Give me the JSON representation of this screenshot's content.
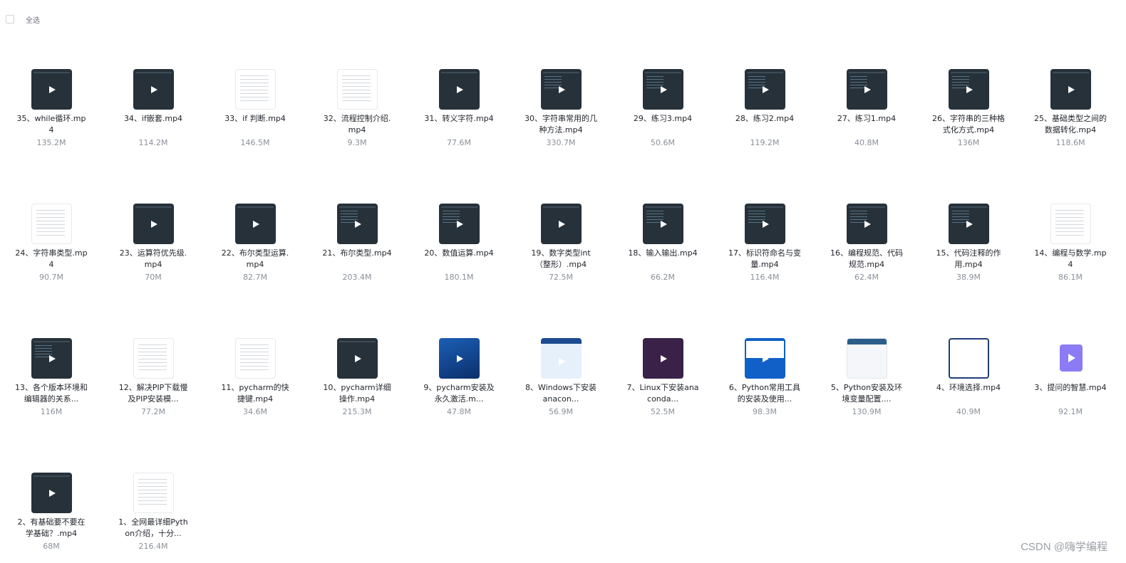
{
  "toolbar": {
    "select_all_label": "全选"
  },
  "files": [
    {
      "name": "35、while循环.mp4",
      "size": "135.2M",
      "thumb": "dark"
    },
    {
      "name": "34、if嵌套.mp4",
      "size": "114.2M",
      "thumb": "dark"
    },
    {
      "name": "33、if 判断.mp4",
      "size": "146.5M",
      "thumb": "doc"
    },
    {
      "name": "32、流程控制介绍.mp4",
      "size": "9.3M",
      "thumb": "doc"
    },
    {
      "name": "31、转义字符.mp4",
      "size": "77.6M",
      "thumb": "dark"
    },
    {
      "name": "30、字符串常用的几种方法.mp4",
      "size": "330.7M",
      "thumb": "code"
    },
    {
      "name": "29、练习3.mp4",
      "size": "50.6M",
      "thumb": "code"
    },
    {
      "name": "28、练习2.mp4",
      "size": "119.2M",
      "thumb": "code"
    },
    {
      "name": "27、练习1.mp4",
      "size": "40.8M",
      "thumb": "code"
    },
    {
      "name": "26、字符串的三种格式化方式.mp4",
      "size": "136M",
      "thumb": "code"
    },
    {
      "name": "25、基础类型之间的数据转化.mp4",
      "size": "118.6M",
      "thumb": "dark"
    },
    {
      "name": "24、字符串类型.mp4",
      "size": "90.7M",
      "thumb": "doc"
    },
    {
      "name": "23、运算符优先级.mp4",
      "size": "70M",
      "thumb": "dark"
    },
    {
      "name": "22、布尔类型运算.mp4",
      "size": "82.7M",
      "thumb": "dark"
    },
    {
      "name": "21、布尔类型.mp4",
      "size": "203.4M",
      "thumb": "code"
    },
    {
      "name": "20、数值运算.mp4",
      "size": "180.1M",
      "thumb": "code"
    },
    {
      "name": "19、数字类型int（整形）.mp4",
      "size": "72.5M",
      "thumb": "dark"
    },
    {
      "name": "18、输入输出.mp4",
      "size": "66.2M",
      "thumb": "code"
    },
    {
      "name": "17、标识符命名与变量.mp4",
      "size": "116.4M",
      "thumb": "code"
    },
    {
      "name": "16、编程规范、代码规范.mp4",
      "size": "62.4M",
      "thumb": "code"
    },
    {
      "name": "15、代码注释的作用.mp4",
      "size": "38.9M",
      "thumb": "code"
    },
    {
      "name": "14、编程与数学.mp4",
      "size": "86.1M",
      "thumb": "doc"
    },
    {
      "name": "13、各个版本环境和编辑器的关系...",
      "size": "116M",
      "thumb": "code"
    },
    {
      "name": "12、解决PIP下载慢及PIP安装模...",
      "size": "77.2M",
      "thumb": "doc"
    },
    {
      "name": "11、pycharm的快捷键.mp4",
      "size": "34.6M",
      "thumb": "doc"
    },
    {
      "name": "10、pycharm详细操作.mp4",
      "size": "215.3M",
      "thumb": "dark"
    },
    {
      "name": "9、pycharm安装及永久激活.m...",
      "size": "47.8M",
      "thumb": "blue"
    },
    {
      "name": "8、Windows下安装anacon...",
      "size": "56.9M",
      "thumb": "win"
    },
    {
      "name": "7、Linux下安装anaconda...",
      "size": "52.5M",
      "thumb": "purple"
    },
    {
      "name": "6、Python常用工具的安装及使用...",
      "size": "98.3M",
      "thumb": "winblue"
    },
    {
      "name": "5、Python安装及环境变量配置....",
      "size": "130.9M",
      "thumb": "light"
    },
    {
      "name": "4、环境选择.mp4",
      "size": "40.9M",
      "thumb": "frame"
    },
    {
      "name": "3、提问的智慧.mp4",
      "size": "92.1M",
      "thumb": "icon"
    },
    {
      "name": "2、有基础要不要在学基础？.mp4",
      "size": "68M",
      "thumb": "dark"
    },
    {
      "name": "1、全网最详细Python介绍，十分...",
      "size": "216.4M",
      "thumb": "doc"
    }
  ],
  "watermark": "CSDN @嗨学编程"
}
